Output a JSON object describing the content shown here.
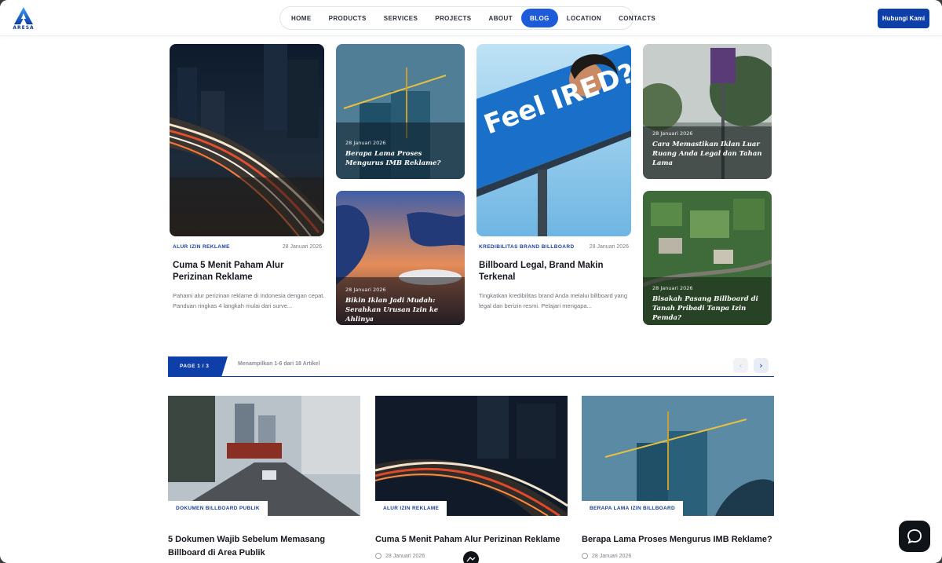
{
  "brand": {
    "logo_text": "ARESA"
  },
  "nav": {
    "items": [
      "HOME",
      "PRODUCTS",
      "SERVICES",
      "PROJECTS",
      "ABOUT",
      "BLOG",
      "LOCATION",
      "CONTACTS"
    ],
    "active": "BLOG",
    "cta_label": "Hubungi Kami"
  },
  "featured": [
    {
      "category": "ALUR IZIN REKLAME",
      "date": "28 Januari 2026",
      "title": "Cuma 5 Menit Paham Alur Perizinan Reklame",
      "excerpt": "Pahami alur perizinan reklame di Indonesia dengan cepat. Panduan ringkas 4 langkah mulai dari surve..."
    },
    {
      "date": "28 Januari 2026",
      "title": "Berapa Lama Proses Mengurus IMB Reklame?"
    },
    {
      "date": "28 Januari 2026",
      "title": "Bikin Iklan Jadi Mudah: Serahkan Urusan Izin ke Ahlinya"
    },
    {
      "category": "KREDIBILITAS BRAND BILLBOARD",
      "date": "28 Januari 2026",
      "title": "Billboard Legal, Brand Makin Terkenal",
      "excerpt": "Tingkatkan kredibilitas brand Anda melalui billboard yang legal dan berizin resmi. Pelajari mengapa...",
      "image_text": "Feel IRED?"
    },
    {
      "date": "28 Januari 2026",
      "title": "Cara Memastikan Iklan Luar Ruang Anda Legal dan Tahan Lama"
    },
    {
      "date": "28 Januari 2026",
      "title": "Bisakah Pasang Billboard di Tanah Pribadi Tanpa Izin Pemda?"
    }
  ],
  "pagination": {
    "page_label": "PAGE 1 / 3",
    "info": "Menampilkan 1-6 dari 18 Artikel",
    "prev_icon": "chevron-left-icon",
    "next_icon": "chevron-right-icon"
  },
  "articles": [
    {
      "category": "DOKUMEN BILLBOARD PUBLIK",
      "title": "5 Dokumen Wajib Sebelum Memasang Billboard di Area Publik",
      "date": ""
    },
    {
      "category": "ALUR IZIN REKLAME",
      "title": "Cuma 5 Menit Paham Alur Perizinan Reklame",
      "date": "28 Januari 2026"
    },
    {
      "category": "BERAPA LAMA IZIN BILLBOARD",
      "title": "Berapa Lama Proses Mengurus IMB Reklame?",
      "date": "28 Januari 2026"
    }
  ],
  "colors": {
    "primary": "#0e3ea8",
    "nav_active": "#1d5bd8",
    "heading": "#151820",
    "muted": "#7a7f88"
  }
}
